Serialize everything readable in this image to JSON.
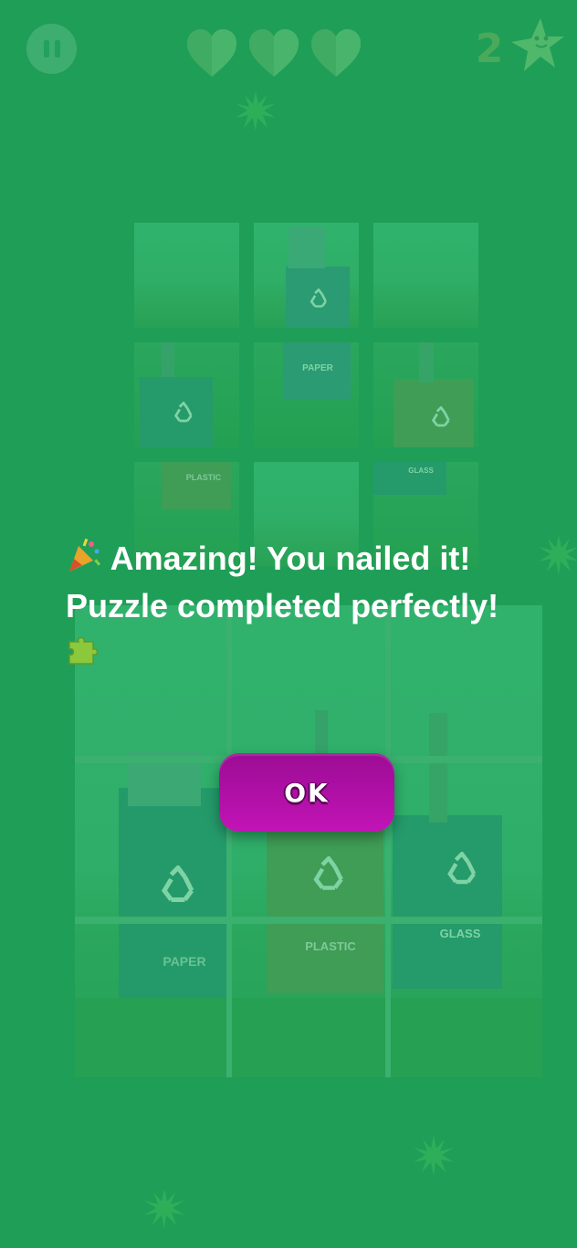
{
  "hud": {
    "pause_icon": "pause-icon",
    "lives": 3,
    "score": "2",
    "mascot_icon": "star-mascot-icon"
  },
  "puzzle": {
    "bin_labels": {
      "paper": "PAPER",
      "plastic": "PLASTIC",
      "glass": "GLASS"
    }
  },
  "dialog": {
    "line1": "Amazing! You nailed it!",
    "line2": "Puzzle completed perfectly!",
    "leading_icon": "party-popper-icon",
    "trailing_icon": "puzzle-piece-icon",
    "ok_label": "OK"
  },
  "colors": {
    "overlay_green": "#1f9e58",
    "button_magenta": "#b310a8",
    "text": "#ffffff"
  }
}
